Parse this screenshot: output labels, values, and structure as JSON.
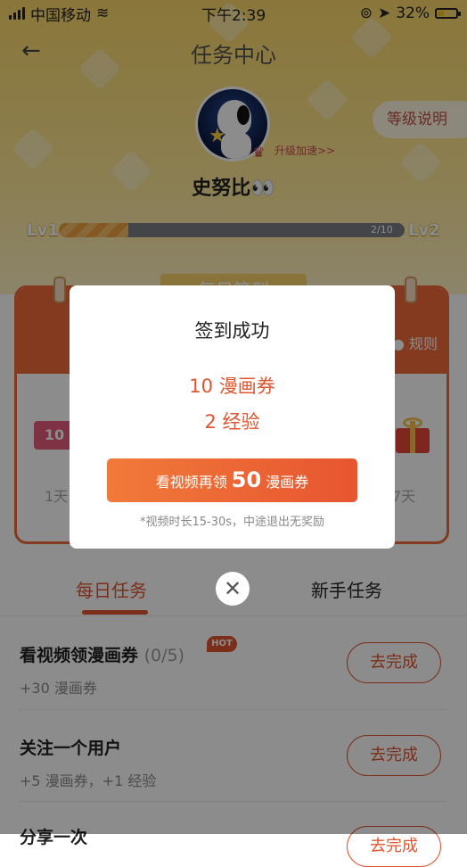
{
  "status_bar": {
    "carrier": "中国移动",
    "time": "下午2:39",
    "battery": "32%"
  },
  "header": {
    "title": "任务中心",
    "upgrade_link": "升级加速>>",
    "level_button": "等级说明",
    "username": "史努比👀"
  },
  "level": {
    "current": "Lv1",
    "next": "Lv2",
    "progress_text": "2/10",
    "progress_fraction": 0.2
  },
  "signin_card": {
    "ribbon": "每日签到",
    "rules": "规则",
    "ticket_value": "10",
    "first_day": "1天",
    "last_day": "7天"
  },
  "tabs": [
    {
      "label": "每日任务",
      "active": true
    },
    {
      "label": "新手任务",
      "active": false
    }
  ],
  "tasks": [
    {
      "title": "看视频领漫画券",
      "count": "(0/5)",
      "badge": "HOT",
      "reward": "+30 漫画券",
      "button": "去完成"
    },
    {
      "title": "关注一个用户",
      "count": "",
      "badge": "",
      "reward": "+5 漫画券，+1 经验",
      "button": "去完成"
    },
    {
      "title": "分享一次",
      "count": "",
      "badge": "",
      "reward": "",
      "button": "去完成"
    }
  ],
  "modal": {
    "title": "签到成功",
    "reward_1": "10 漫画券",
    "reward_2": "2 经验",
    "video_btn_prefix": "看视频再领 ",
    "video_btn_amount": "50",
    "video_btn_suffix": " 漫画券",
    "note": "*视频时长15-30s，中途退出无奖励"
  },
  "colors": {
    "accent": "#e0552e",
    "header_bg": "#fbd86a"
  }
}
